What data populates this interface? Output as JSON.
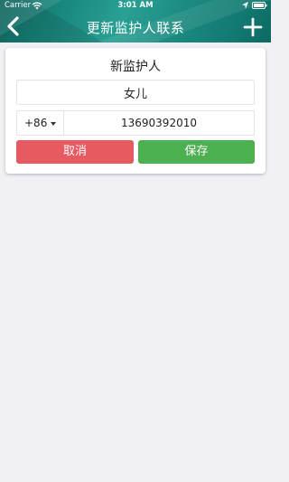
{
  "status_bar": {
    "carrier": "Carrier",
    "time": "3:01 AM"
  },
  "nav": {
    "title": "更新监护人联系",
    "back_icon": "chevron-left-icon",
    "add_icon": "plus-icon"
  },
  "form": {
    "title": "新监护人",
    "relation_value": "女儿",
    "country_code": "+86",
    "phone_value": "13690392010",
    "cancel_label": "取消",
    "save_label": "保存"
  },
  "colors": {
    "header": "#1a8a80",
    "cancel": "#e85a62",
    "save": "#4caf50",
    "background": "#f0f0f5"
  }
}
